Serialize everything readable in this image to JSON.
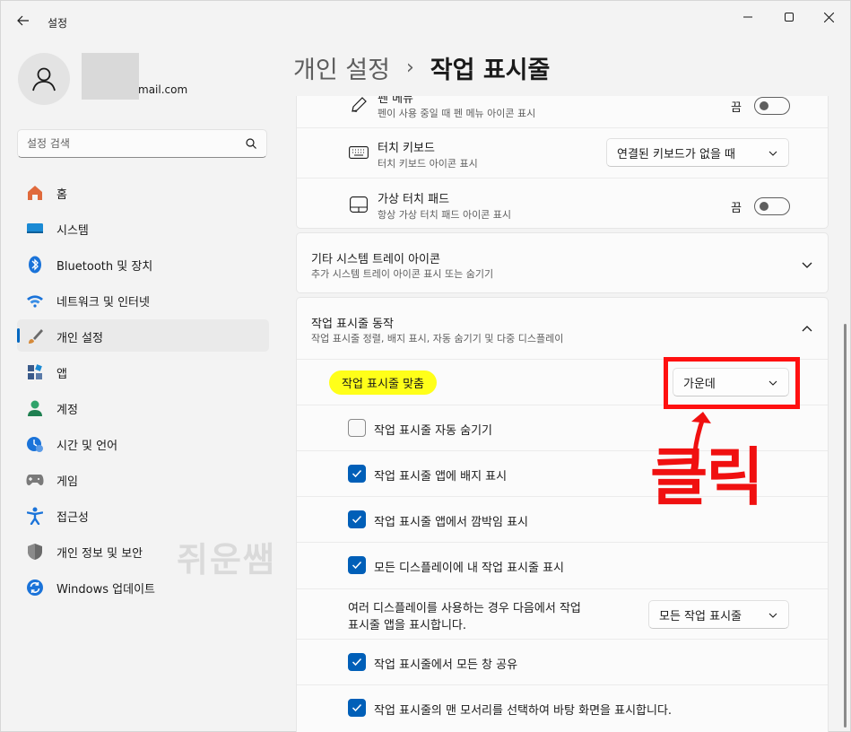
{
  "app": {
    "title": "설정"
  },
  "window_controls": {
    "minimize": "minimize",
    "maximize": "maximize",
    "close": "close"
  },
  "profile": {
    "email_suffix": "mail.com"
  },
  "search": {
    "placeholder": "설정 검색"
  },
  "sidebar": {
    "items": [
      {
        "label": "홈",
        "icon": "home-icon",
        "color": "#e06a3c"
      },
      {
        "label": "시스템",
        "icon": "system-icon",
        "color": "#1a8ad4"
      },
      {
        "label": "Bluetooth 및 장치",
        "icon": "bluetooth-icon",
        "color": "#1a73d9"
      },
      {
        "label": "네트워크 및 인터넷",
        "icon": "wifi-icon",
        "color": "#1a73d9"
      },
      {
        "label": "개인 설정",
        "icon": "brush-icon",
        "color": "#d58a3a",
        "active": true
      },
      {
        "label": "앱",
        "icon": "apps-icon",
        "color": "#3a5a8a"
      },
      {
        "label": "계정",
        "icon": "account-icon",
        "color": "#2fa36b"
      },
      {
        "label": "시간 및 언어",
        "icon": "time-language-icon",
        "color": "#1a73d9"
      },
      {
        "label": "게임",
        "icon": "gaming-icon",
        "color": "#7a7a7a"
      },
      {
        "label": "접근성",
        "icon": "accessibility-icon",
        "color": "#1a73d9"
      },
      {
        "label": "개인 정보 및 보안",
        "icon": "shield-icon",
        "color": "#6a6a6a"
      },
      {
        "label": "Windows 업데이트",
        "icon": "update-icon",
        "color": "#1a73d9"
      }
    ]
  },
  "watermark": "쥐운쌤",
  "breadcrumb": {
    "parent": "개인 설정",
    "separator": "›",
    "current": "작업 표시줄"
  },
  "tray_icons": {
    "pen_menu": {
      "title": "펜 메뉴",
      "subtitle": "펜이 사용 중일 때 펜 메뉴 아이콘 표시",
      "toggle": "끔"
    },
    "touch_keyboard": {
      "title": "터치 키보드",
      "subtitle": "터치 키보드 아이콘 표시",
      "dropdown": "연결된 키보드가 없을 때"
    },
    "virtual_touchpad": {
      "title": "가상 터치 패드",
      "subtitle": "항상 가상 터치 패드 아이콘 표시",
      "toggle": "끔"
    }
  },
  "other_tray": {
    "title": "기타 시스템 트레이 아이콘",
    "subtitle": "추가 시스템 트레이 아이콘 표시 또는 숨기기"
  },
  "behaviors": {
    "title": "작업 표시줄 동작",
    "subtitle": "작업 표시줄 정렬, 배지 표시, 자동 숨기기 및 다중 디스플레이",
    "alignment": {
      "label": "작업 표시줄 맞춤",
      "value": "가운데"
    },
    "checks": [
      {
        "label": "작업 표시줄 자동 숨기기",
        "checked": false
      },
      {
        "label": "작업 표시줄 앱에 배지 표시",
        "checked": true
      },
      {
        "label": "작업 표시줄 앱에서 깜박임 표시",
        "checked": true
      },
      {
        "label": "모든 디스플레이에 내 작업 표시줄 표시",
        "checked": true
      }
    ],
    "multi_display": {
      "label_line1": "여러 디스플레이를 사용하는 경우 다음에서 작업",
      "label_line2": "표시줄 앱을 표시합니다.",
      "value": "모든 작업 표시줄"
    },
    "checks2": [
      {
        "label": "작업 표시줄에서 모든 창 공유",
        "checked": true
      },
      {
        "label": "작업 표시줄의 맨 모서리를 선택하여 바탕 화면을 표시합니다.",
        "checked": true
      }
    ]
  },
  "annotation": {
    "text": "클릭",
    "color": "#f01010"
  }
}
